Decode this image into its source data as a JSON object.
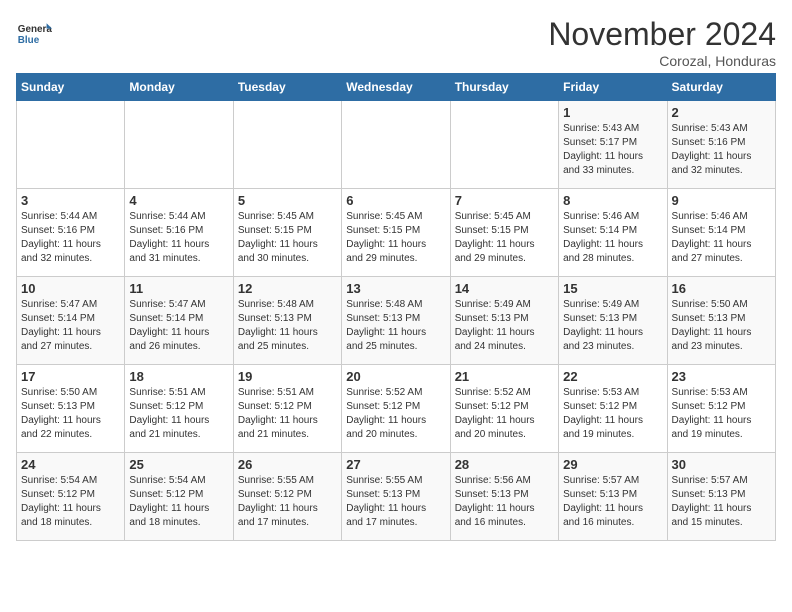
{
  "header": {
    "logo_general": "General",
    "logo_blue": "Blue",
    "month_title": "November 2024",
    "location": "Corozal, Honduras"
  },
  "days_of_week": [
    "Sunday",
    "Monday",
    "Tuesday",
    "Wednesday",
    "Thursday",
    "Friday",
    "Saturday"
  ],
  "weeks": [
    [
      {
        "day": "",
        "info": ""
      },
      {
        "day": "",
        "info": ""
      },
      {
        "day": "",
        "info": ""
      },
      {
        "day": "",
        "info": ""
      },
      {
        "day": "",
        "info": ""
      },
      {
        "day": "1",
        "info": "Sunrise: 5:43 AM\nSunset: 5:17 PM\nDaylight: 11 hours\nand 33 minutes."
      },
      {
        "day": "2",
        "info": "Sunrise: 5:43 AM\nSunset: 5:16 PM\nDaylight: 11 hours\nand 32 minutes."
      }
    ],
    [
      {
        "day": "3",
        "info": "Sunrise: 5:44 AM\nSunset: 5:16 PM\nDaylight: 11 hours\nand 32 minutes."
      },
      {
        "day": "4",
        "info": "Sunrise: 5:44 AM\nSunset: 5:16 PM\nDaylight: 11 hours\nand 31 minutes."
      },
      {
        "day": "5",
        "info": "Sunrise: 5:45 AM\nSunset: 5:15 PM\nDaylight: 11 hours\nand 30 minutes."
      },
      {
        "day": "6",
        "info": "Sunrise: 5:45 AM\nSunset: 5:15 PM\nDaylight: 11 hours\nand 29 minutes."
      },
      {
        "day": "7",
        "info": "Sunrise: 5:45 AM\nSunset: 5:15 PM\nDaylight: 11 hours\nand 29 minutes."
      },
      {
        "day": "8",
        "info": "Sunrise: 5:46 AM\nSunset: 5:14 PM\nDaylight: 11 hours\nand 28 minutes."
      },
      {
        "day": "9",
        "info": "Sunrise: 5:46 AM\nSunset: 5:14 PM\nDaylight: 11 hours\nand 27 minutes."
      }
    ],
    [
      {
        "day": "10",
        "info": "Sunrise: 5:47 AM\nSunset: 5:14 PM\nDaylight: 11 hours\nand 27 minutes."
      },
      {
        "day": "11",
        "info": "Sunrise: 5:47 AM\nSunset: 5:14 PM\nDaylight: 11 hours\nand 26 minutes."
      },
      {
        "day": "12",
        "info": "Sunrise: 5:48 AM\nSunset: 5:13 PM\nDaylight: 11 hours\nand 25 minutes."
      },
      {
        "day": "13",
        "info": "Sunrise: 5:48 AM\nSunset: 5:13 PM\nDaylight: 11 hours\nand 25 minutes."
      },
      {
        "day": "14",
        "info": "Sunrise: 5:49 AM\nSunset: 5:13 PM\nDaylight: 11 hours\nand 24 minutes."
      },
      {
        "day": "15",
        "info": "Sunrise: 5:49 AM\nSunset: 5:13 PM\nDaylight: 11 hours\nand 23 minutes."
      },
      {
        "day": "16",
        "info": "Sunrise: 5:50 AM\nSunset: 5:13 PM\nDaylight: 11 hours\nand 23 minutes."
      }
    ],
    [
      {
        "day": "17",
        "info": "Sunrise: 5:50 AM\nSunset: 5:13 PM\nDaylight: 11 hours\nand 22 minutes."
      },
      {
        "day": "18",
        "info": "Sunrise: 5:51 AM\nSunset: 5:12 PM\nDaylight: 11 hours\nand 21 minutes."
      },
      {
        "day": "19",
        "info": "Sunrise: 5:51 AM\nSunset: 5:12 PM\nDaylight: 11 hours\nand 21 minutes."
      },
      {
        "day": "20",
        "info": "Sunrise: 5:52 AM\nSunset: 5:12 PM\nDaylight: 11 hours\nand 20 minutes."
      },
      {
        "day": "21",
        "info": "Sunrise: 5:52 AM\nSunset: 5:12 PM\nDaylight: 11 hours\nand 20 minutes."
      },
      {
        "day": "22",
        "info": "Sunrise: 5:53 AM\nSunset: 5:12 PM\nDaylight: 11 hours\nand 19 minutes."
      },
      {
        "day": "23",
        "info": "Sunrise: 5:53 AM\nSunset: 5:12 PM\nDaylight: 11 hours\nand 19 minutes."
      }
    ],
    [
      {
        "day": "24",
        "info": "Sunrise: 5:54 AM\nSunset: 5:12 PM\nDaylight: 11 hours\nand 18 minutes."
      },
      {
        "day": "25",
        "info": "Sunrise: 5:54 AM\nSunset: 5:12 PM\nDaylight: 11 hours\nand 18 minutes."
      },
      {
        "day": "26",
        "info": "Sunrise: 5:55 AM\nSunset: 5:12 PM\nDaylight: 11 hours\nand 17 minutes."
      },
      {
        "day": "27",
        "info": "Sunrise: 5:55 AM\nSunset: 5:13 PM\nDaylight: 11 hours\nand 17 minutes."
      },
      {
        "day": "28",
        "info": "Sunrise: 5:56 AM\nSunset: 5:13 PM\nDaylight: 11 hours\nand 16 minutes."
      },
      {
        "day": "29",
        "info": "Sunrise: 5:57 AM\nSunset: 5:13 PM\nDaylight: 11 hours\nand 16 minutes."
      },
      {
        "day": "30",
        "info": "Sunrise: 5:57 AM\nSunset: 5:13 PM\nDaylight: 11 hours\nand 15 minutes."
      }
    ]
  ]
}
